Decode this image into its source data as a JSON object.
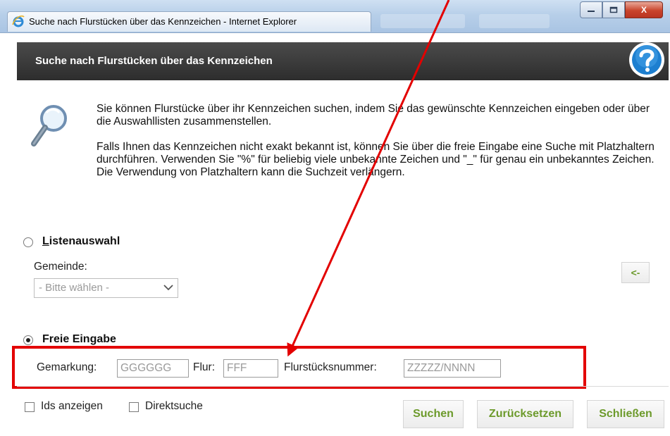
{
  "window": {
    "title": "Suche nach Flurstücken über das Kennzeichen - Internet Explorer",
    "minimize_icon": "minimize-icon",
    "maximize_icon": "maximize-icon",
    "close_label": "X"
  },
  "header": {
    "title": "Suche nach Flurstücken über das Kennzeichen",
    "help_icon": "help-icon"
  },
  "intro": {
    "paragraph1": "Sie können Flurstücke über ihr Kennzeichen suchen, indem Sie das gewünschte Kennzeichen eingeben oder über die Auswahllisten zusammenstellen.",
    "paragraph2": "Falls Ihnen das Kennzeichen nicht exakt bekannt ist, können Sie über die freie Eingabe eine Suche mit Platzhaltern durchführen. Verwenden Sie \"%\" für beliebig viele unbekannte Zeichen und \"_\" für genau ein unbekanntes Zeichen. Die Verwendung von Platzhaltern kann die Suchzeit verlängern."
  },
  "list_selection": {
    "label_accesskey": "L",
    "label_rest": "istenauswahl",
    "selected": false,
    "gemeinde_label": "Gemeinde:",
    "gemeinde_value": "- Bitte wählen -",
    "arrow_button": "<-"
  },
  "free_input": {
    "label": "Freie Eingabe",
    "selected": true,
    "gemarkung_label": "Gemarkung:",
    "gemarkung_placeholder": "GGGGGG",
    "flur_label": "Flur:",
    "flur_placeholder": "FFF",
    "flurstueck_label": "Flurstücksnummer:",
    "flurstueck_placeholder": "ZZZZZ/NNNN"
  },
  "options": {
    "ids_label": "Ids anzeigen",
    "ids_checked": false,
    "direkt_label": "Direktsuche",
    "direkt_checked": false
  },
  "buttons": {
    "search": "Suchen",
    "reset": "Zurücksetzen",
    "close": "Schließen"
  },
  "colors": {
    "accent_green": "#6c9a2b",
    "annotation_red": "#e30000",
    "header_bg": "#3a3a3a"
  }
}
